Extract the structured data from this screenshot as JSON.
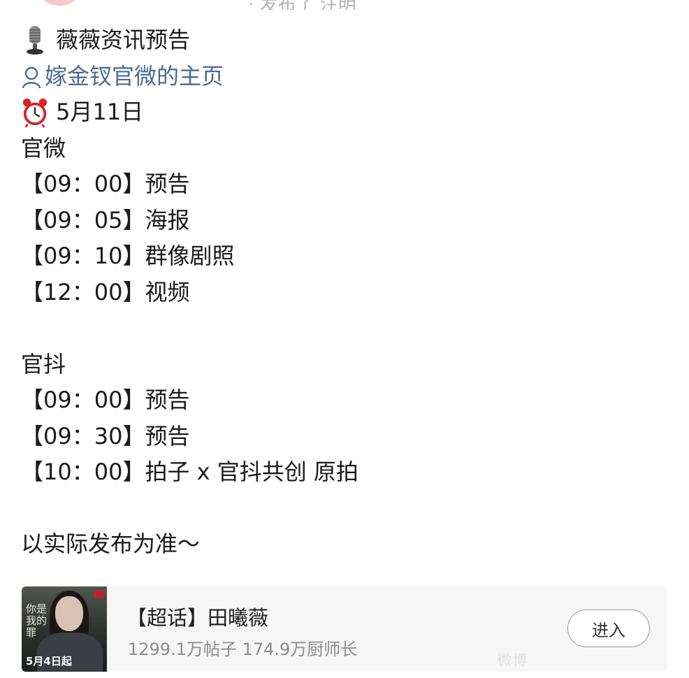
{
  "top_partial": {
    "meta_text": "· 发布了 注明"
  },
  "post": {
    "header_title": "薇薇资讯预告",
    "profile_link": "嫁金钗官微的主页",
    "date": "5月11日",
    "sections": [
      {
        "name": "官微",
        "items": [
          {
            "time": "【09：00】",
            "event": "预告"
          },
          {
            "time": "【09：05】",
            "event": "海报"
          },
          {
            "time": "【09：10】",
            "event": "群像剧照"
          },
          {
            "time": "【12：00】",
            "event": "视频"
          }
        ]
      },
      {
        "name": "官抖",
        "items": [
          {
            "time": "【09：00】",
            "event": "预告"
          },
          {
            "time": "【09：30】",
            "event": "预告"
          },
          {
            "time": "【10：00】",
            "event": "拍子 x 官抖共创 原拍"
          }
        ]
      }
    ],
    "footer_note": "以实际发布为准～"
  },
  "supertopic": {
    "title": "【超话】田曦薇",
    "stats": "1299.1万帖子 174.9万厨师长",
    "enter_label": "进入",
    "thumbnail": {
      "title_art": "你是我的罪",
      "date_badge": "5月4日起"
    }
  },
  "watermark": "微博"
}
